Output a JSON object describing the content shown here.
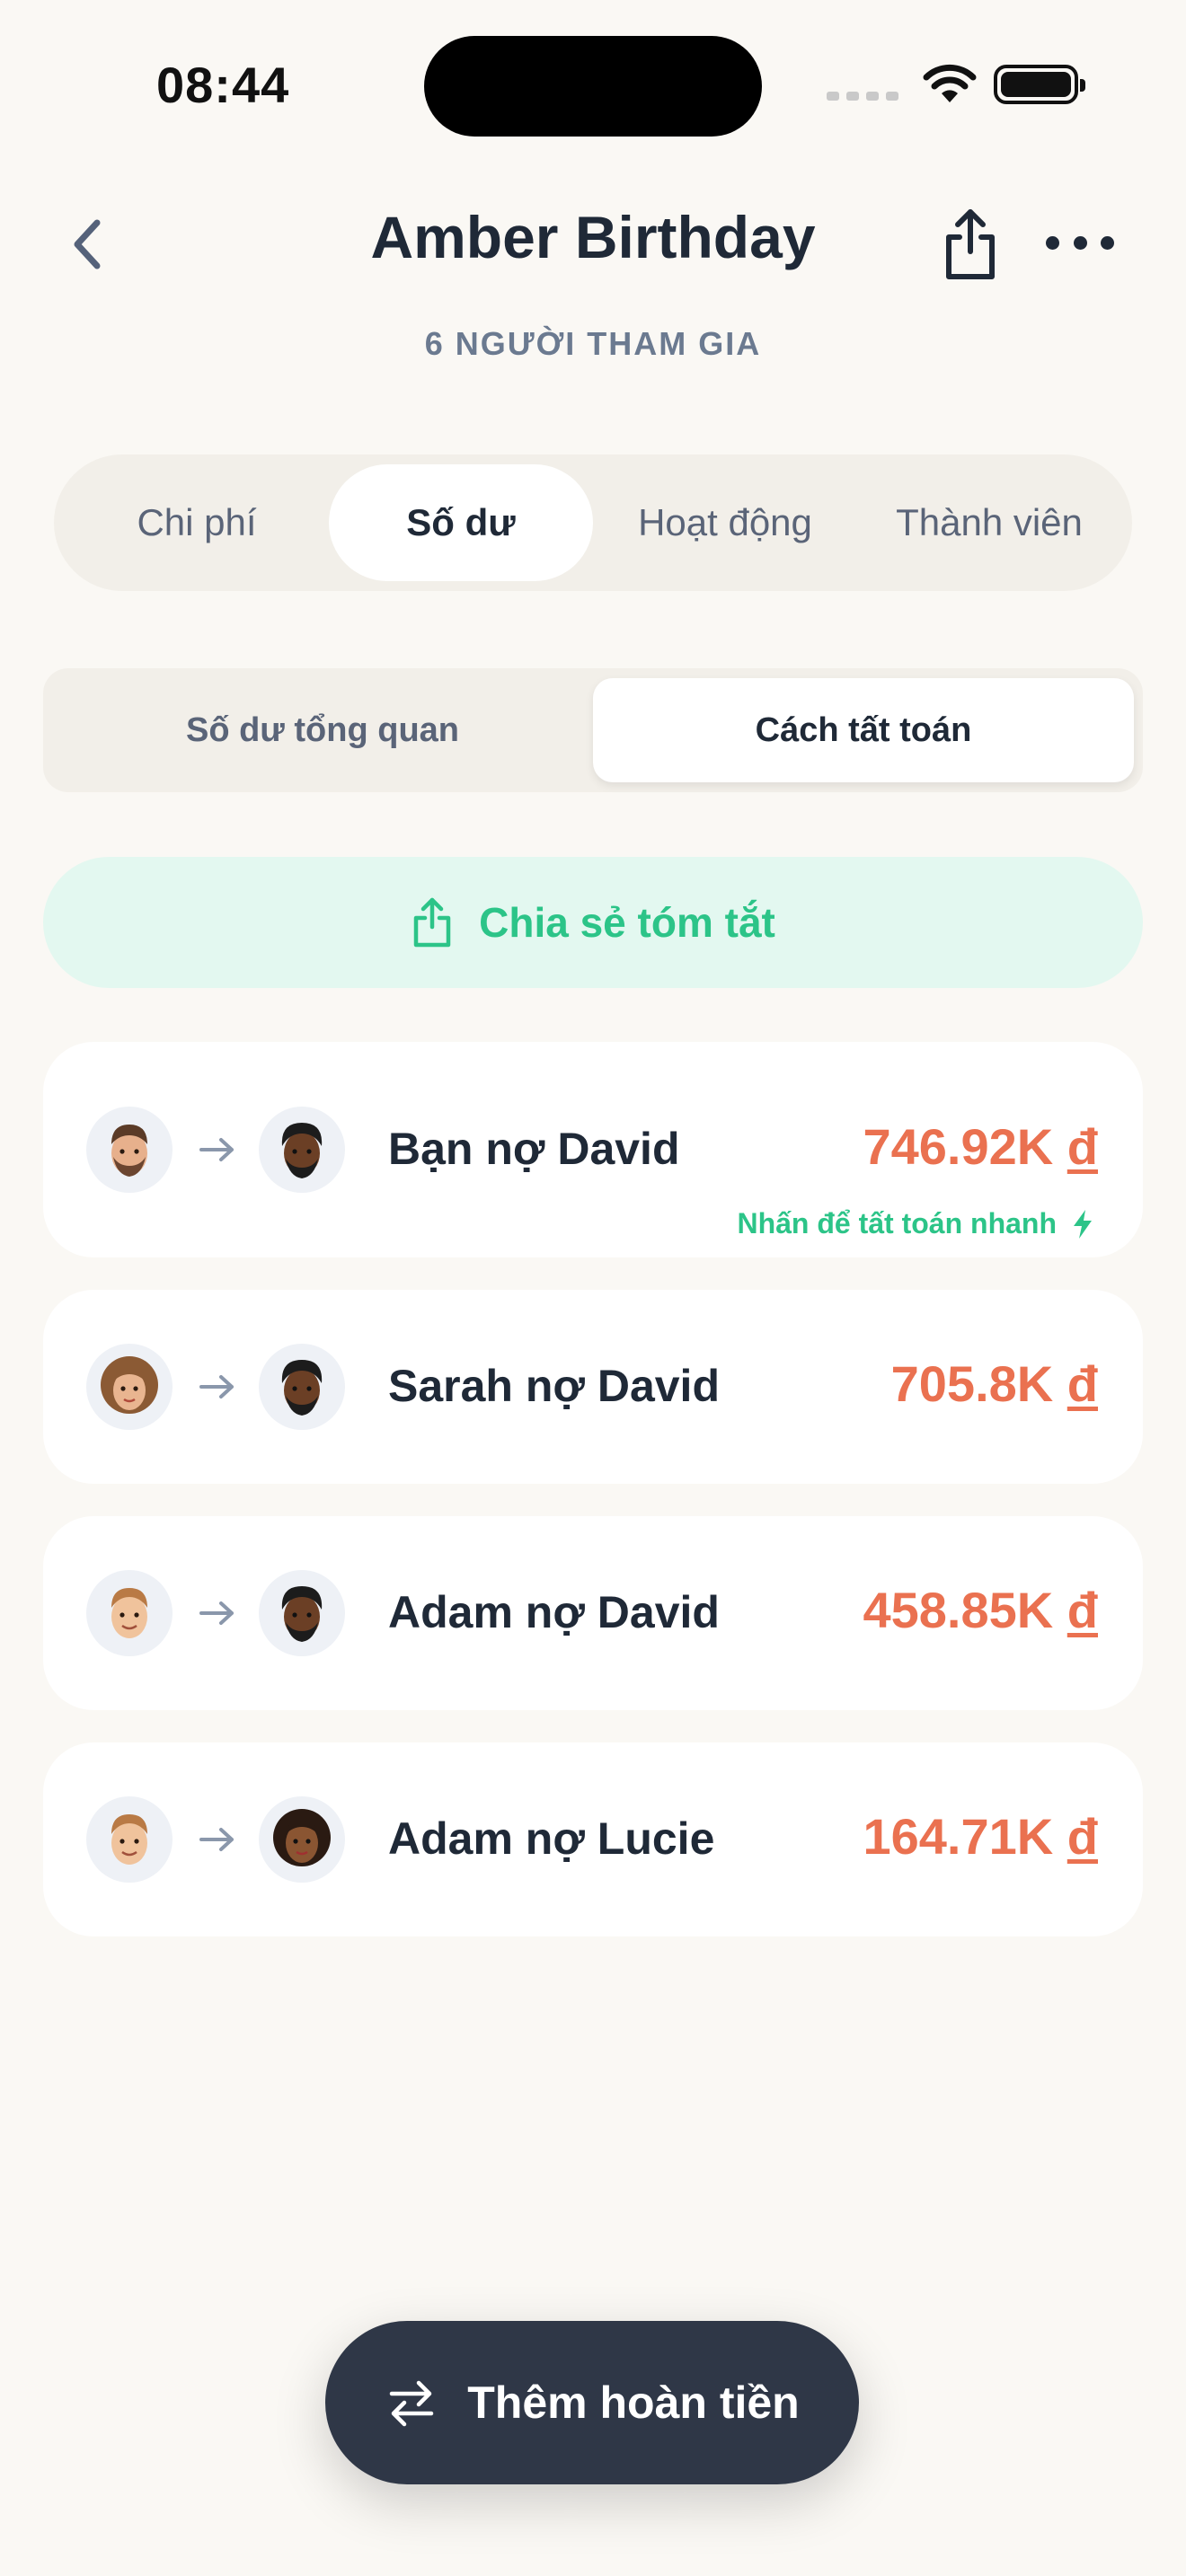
{
  "status_bar": {
    "time": "08:44"
  },
  "header": {
    "title": "Amber Birthday",
    "participants": "6 NGƯỜI THAM GIA"
  },
  "tabs": [
    {
      "label": "Chi phí",
      "active": false
    },
    {
      "label": "Số dư",
      "active": true
    },
    {
      "label": "Hoạt động",
      "active": false
    },
    {
      "label": "Thành viên",
      "active": false
    }
  ],
  "segment": [
    {
      "label": "Số dư tổng quan",
      "active": false
    },
    {
      "label": "Cách tất toán",
      "active": true
    }
  ],
  "share_summary": {
    "label": "Chia sẻ tóm tắt"
  },
  "debts": [
    {
      "text": "Bạn nợ David",
      "amount": "746.92K",
      "currency": "đ",
      "quick_settle": "Nhấn để tất toán nhanh"
    },
    {
      "text": "Sarah nợ David",
      "amount": "705.8K",
      "currency": "đ"
    },
    {
      "text": "Adam nợ David",
      "amount": "458.85K",
      "currency": "đ"
    },
    {
      "text": "Adam nợ Lucie",
      "amount": "164.71K",
      "currency": "đ"
    }
  ],
  "fab": {
    "label": "Thêm hoàn tiền"
  },
  "colors": {
    "accent_green": "#2cc488",
    "amount_orange": "#ea7150",
    "fab_bg": "#2f3747"
  }
}
